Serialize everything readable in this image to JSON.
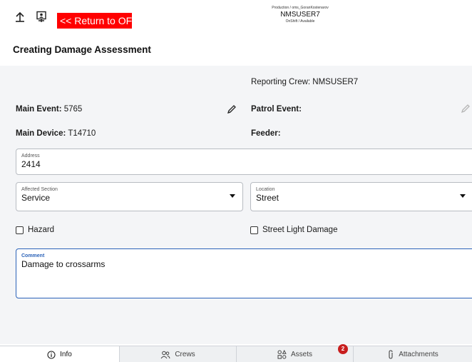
{
  "header": {
    "return_label": "<< Return to OFS",
    "environment": "Production / oms_GoranKostenarov",
    "user": "NMSUSER7",
    "state": "OnShift / Available"
  },
  "page": {
    "title": "Creating Damage Assessment"
  },
  "form": {
    "reporting_crew": "Reporting Crew: NMSUSER7",
    "main_event_label": "Main Event:",
    "main_event_value": "5765",
    "patrol_event_label": "Patrol Event:",
    "patrol_event_value": "",
    "main_device_label": "Main Device:",
    "main_device_value": "T14710",
    "feeder_label": "Feeder:",
    "feeder_value": "",
    "address": {
      "label": "Address",
      "value": "2414"
    },
    "affected_section": {
      "label": "Affected Section",
      "value": "Service"
    },
    "location": {
      "label": "Location",
      "value": "Street"
    },
    "hazard_label": "Hazard",
    "hazard_checked": false,
    "street_light_label": "Street Light Damage",
    "street_light_checked": false,
    "comment": {
      "label": "Comment",
      "value": "Damage to crossarms"
    }
  },
  "tabs": [
    {
      "label": "Info",
      "icon": "info-icon",
      "active": true
    },
    {
      "label": "Crews",
      "icon": "crews-icon",
      "active": false
    },
    {
      "label": "Assets",
      "icon": "assets-icon",
      "active": false,
      "badge": "2"
    },
    {
      "label": "Attachments",
      "icon": "paperclip-icon",
      "active": false
    }
  ],
  "colors": {
    "return_button": "#ff0000",
    "focus": "#2b62b8",
    "badge": "#c81e1e"
  }
}
